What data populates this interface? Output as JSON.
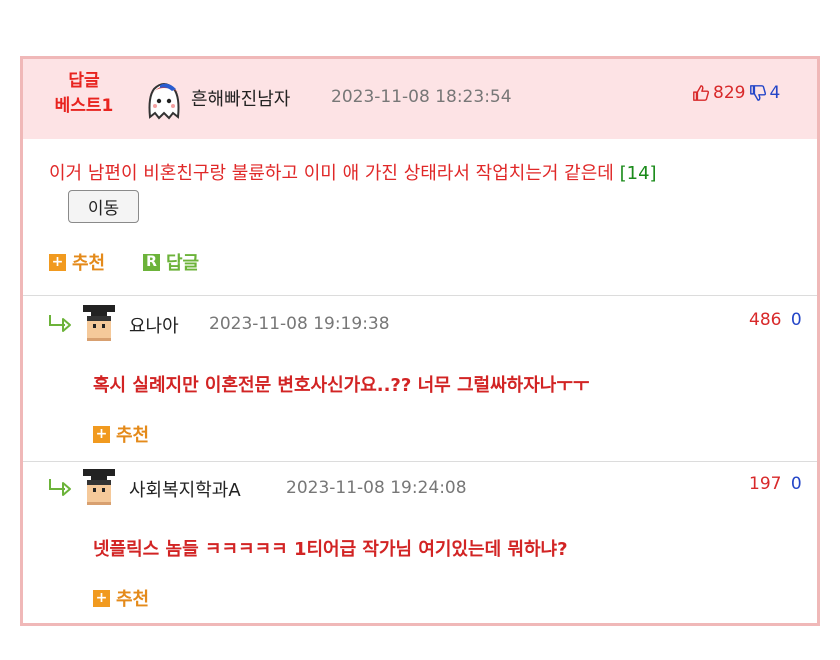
{
  "best_reply": {
    "badge_line1": "답글",
    "badge_line2": "베스트1",
    "author": "흔해빠진남자",
    "timestamp": "2023-11-08 18:23:54",
    "likes": "829",
    "dislikes": "4",
    "text": "이거 남편이 비혼친구랑 불륜하고 이미 애 가진 상태라서 작업치는거 같은데",
    "reply_count": "[14]",
    "move_label": "이동",
    "recommend_label": "추천",
    "reply_label": "답글",
    "recommend_icon": "+",
    "reply_icon": "R"
  },
  "replies": [
    {
      "author": "요나아",
      "timestamp": "2023-11-08 19:19:38",
      "likes": "486",
      "dislikes": "0",
      "text": "혹시 실례지만 이혼전문 변호사신가요..?? 너무 그럴싸하자나ㅜㅜ",
      "recommend_label": "추천",
      "recommend_icon": "+"
    },
    {
      "author": "사회복지학과A",
      "timestamp": "2023-11-08 19:24:08",
      "likes": "197",
      "dislikes": "0",
      "text": "넷플릭스 놈들 ㅋㅋㅋㅋㅋ 1티어급 작가님 여기있는데 뭐하냐?",
      "recommend_label": "추천",
      "recommend_icon": "+"
    }
  ],
  "colors": {
    "header_bg": "#fde3e5",
    "border": "#f0b8b8",
    "red_text": "#e02828",
    "orange": "#f19a1f",
    "green": "#6cb33a",
    "blue": "#2446c8"
  }
}
